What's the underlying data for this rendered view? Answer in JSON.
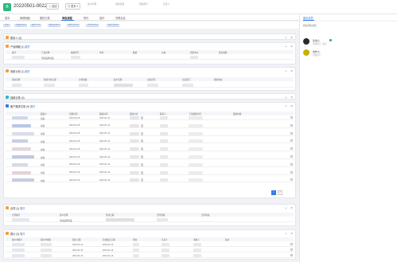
{
  "header": {
    "logo_text": "B",
    "title": "20220501-0022",
    "back_button": "◁ 返回",
    "more_button": "⊘ 更多 ▾",
    "meta_1": "客户名称",
    "meta_2": "创建日期",
    "meta_3": "所属部门",
    "meta_4": "负责人"
  },
  "tabs": [
    "基本",
    "管理明细",
    "跟进记录",
    "审批流程",
    "附件",
    "操作",
    "关联信息"
  ],
  "active_tab_index": 3,
  "filters": [
    "全部",
    "沟通记录(0)",
    "联系人(0)",
    "跟进记录(0)",
    "附件文件(0)",
    "合同订单(0)",
    "收款计划(0)"
  ],
  "panels": {
    "p1": {
      "title": "联系人",
      "count": "(0)",
      "color": "#f2a03d"
    },
    "p2": {
      "title": "产品明细",
      "count": "(1)",
      "extra": "展开",
      "color": "#f2a03d",
      "headers": [
        "编号",
        "产品名称",
        "规格型号",
        "单位",
        "数量",
        "价格",
        "销售单价",
        "折后金额"
      ],
      "rows": [
        [
          "",
          "测试品牌商品",
          "",
          "",
          "",
          "",
          "",
          ""
        ]
      ]
    },
    "p3": {
      "title": "收款计划",
      "count": "(1)",
      "extra": "展开",
      "color": "#f2a03d",
      "headers": [
        "期次名称",
        "收款计划日期",
        "计划金额",
        "客户名称",
        "关联合同",
        "负责部门",
        "收款状态"
      ],
      "rows": [
        [
          "",
          "",
          "",
          "",
          "",
          "",
          ""
        ]
      ]
    },
    "p4": {
      "title": "回款记录",
      "count": "(0)",
      "color": "#2db8c7"
    },
    "p5": {
      "title": "客户跟进记录",
      "count": "(9)",
      "extra": "展开",
      "color": "#2e7be6",
      "headers": [
        "",
        "跟进人",
        "创建时间",
        "跟进时间",
        "跟进方式",
        "联系人",
        "下次跟进时间",
        "跟进内容"
      ],
      "rows": [
        [
          "",
          "在职",
          "2021-01-05",
          "2021-01-14",
          "",
          "",
          "",
          ""
        ],
        [
          "",
          "在职",
          "2021-01-05",
          "2021-01-14",
          "",
          "",
          "",
          ""
        ],
        [
          "",
          "在职",
          "2021-01-05",
          "2021-01-14",
          "",
          "",
          "",
          ""
        ],
        [
          "",
          "在职",
          "2021-01-05",
          "2021-01-14",
          "",
          "",
          "",
          ""
        ],
        [
          "",
          "在职",
          "2021-01-05",
          "2021-01-14",
          "",
          "",
          "",
          ""
        ],
        [
          "",
          "在职",
          "2021-01-05",
          "2021-01-14",
          "",
          "",
          "",
          ""
        ],
        [
          "",
          "在职",
          "2021-01-05",
          "2021-01-14",
          "",
          "",
          "",
          ""
        ],
        [
          "",
          "在职",
          "2021-01-05",
          "2021-01-14",
          "",
          "",
          "",
          ""
        ],
        [
          "",
          "在职",
          "2021-01-05",
          "2021-01-14",
          "",
          "",
          "",
          ""
        ]
      ],
      "pager": [
        "1",
        "2"
      ]
    },
    "p6": {
      "title": "合同",
      "count": "(1)",
      "extra": "展开",
      "color": "#f2a03d",
      "headers": [
        "合同编号",
        "客户名称",
        "签约日期",
        "合同金额",
        "合同状态"
      ],
      "rows": [
        [
          "",
          "测试品牌商品",
          "",
          "",
          ""
        ]
      ]
    },
    "p7": {
      "title": "报价",
      "count": "(3)",
      "extra": "展开",
      "color": "#f2a03d",
      "headers": [
        "报价单编号",
        "报价单金额",
        "报价日期",
        "有效截止日期",
        "状态",
        "负责人",
        "审批人",
        "备注"
      ],
      "rows": [
        [
          "",
          "",
          "2021-01-14",
          "2021-01-14",
          "",
          "",
          "",
          ""
        ],
        [
          "",
          "",
          "2021-01-14",
          "2021-01-14",
          "",
          "",
          "",
          ""
        ],
        [
          "",
          "",
          "2021-01-14",
          "2021-01-14",
          "",
          "",
          "",
          ""
        ]
      ]
    }
  },
  "sidebar": {
    "tab": "团队成员",
    "label": "相关团队成员",
    "people": [
      {
        "name": "负责人",
        "sub": "所属部门 · 职位"
      },
      {
        "name": "协作人",
        "sub": "所属部门"
      }
    ]
  },
  "colors": {
    "accent": "#2e7be6",
    "brand": "#2db87d"
  }
}
